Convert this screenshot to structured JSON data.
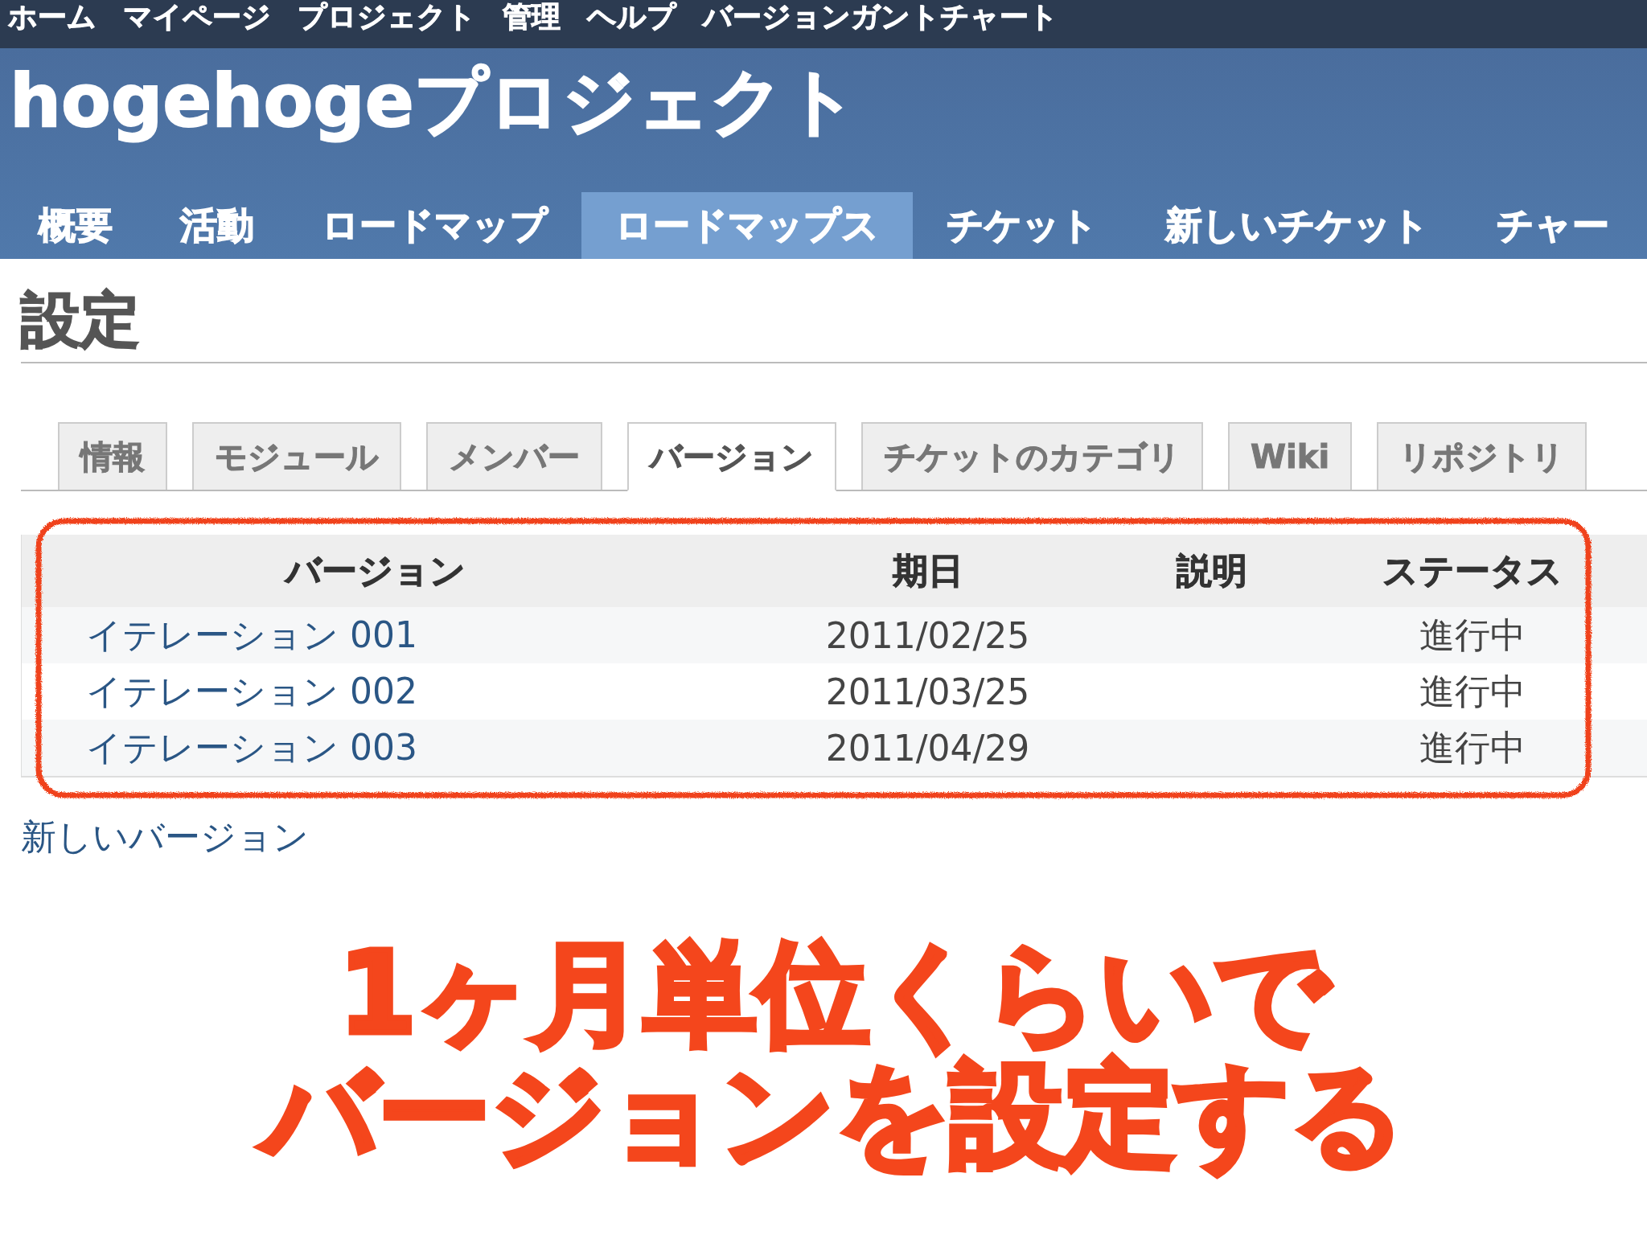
{
  "top_menu": [
    "ホーム",
    "マイページ",
    "プロジェクト",
    "管理",
    "ヘルプ",
    "バージョンガントチャート"
  ],
  "project_title": "hogehogeプロジェクト",
  "main_menu": [
    {
      "label": "概要",
      "selected": false
    },
    {
      "label": "活動",
      "selected": false
    },
    {
      "label": "ロードマップ",
      "selected": false
    },
    {
      "label": "ロードマップス",
      "selected": true
    },
    {
      "label": "チケット",
      "selected": false
    },
    {
      "label": "新しいチケット",
      "selected": false
    },
    {
      "label": "チャー",
      "selected": false
    }
  ],
  "page_title": "設定",
  "settings_tabs": [
    {
      "label": "情報",
      "selected": false
    },
    {
      "label": "モジュール",
      "selected": false
    },
    {
      "label": "メンバー",
      "selected": false
    },
    {
      "label": "バージョン",
      "selected": true
    },
    {
      "label": "チケットのカテゴリ",
      "selected": false
    },
    {
      "label": "Wiki",
      "selected": false
    },
    {
      "label": "リポジトリ",
      "selected": false
    }
  ],
  "versions_table": {
    "columns": [
      "バージョン",
      "期日",
      "説明",
      "ステータス"
    ],
    "rows": [
      {
        "version": "イテレーション 001",
        "date": "2011/02/25",
        "status": "進行中"
      },
      {
        "version": "イテレーション 002",
        "date": "2011/03/25",
        "status": "進行中"
      },
      {
        "version": "イテレーション 003",
        "date": "2011/04/29",
        "status": "進行中"
      }
    ]
  },
  "new_version_link": "新しいバージョン",
  "caption": [
    "1ヶ月単位くらいで",
    "バージョンを設定する"
  ]
}
